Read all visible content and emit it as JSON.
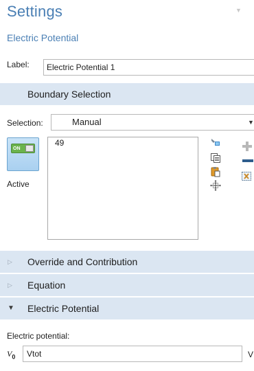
{
  "header": {
    "title": "Settings",
    "subtitle": "Electric Potential"
  },
  "label_field": {
    "label": "Label:",
    "value": "Electric Potential 1"
  },
  "sections": {
    "boundary_selection": "Boundary Selection",
    "override": "Override and Contribution",
    "equation": "Equation",
    "electric_potential": "Electric Potential"
  },
  "selection": {
    "label": "Selection:",
    "value": "Manual",
    "active_toggle_text": "ON",
    "active_label": "Active",
    "items": [
      "49"
    ]
  },
  "icons": [
    "paste-selection-icon",
    "copy-selection-icon",
    "clipboard-paste-icon",
    "zoom-to-selection-icon",
    "add-icon",
    "remove-icon",
    "clear-selection-icon"
  ],
  "potential": {
    "field_label": "Electric potential:",
    "symbol": "V",
    "subscript": "0",
    "value": "Vtot",
    "unit": "V"
  },
  "colors": {
    "title": "#4a7fb4",
    "section_bg": "#dbe6f2",
    "toggle_on": "#6bb34d",
    "remove_icon": "#2d5d8c"
  }
}
